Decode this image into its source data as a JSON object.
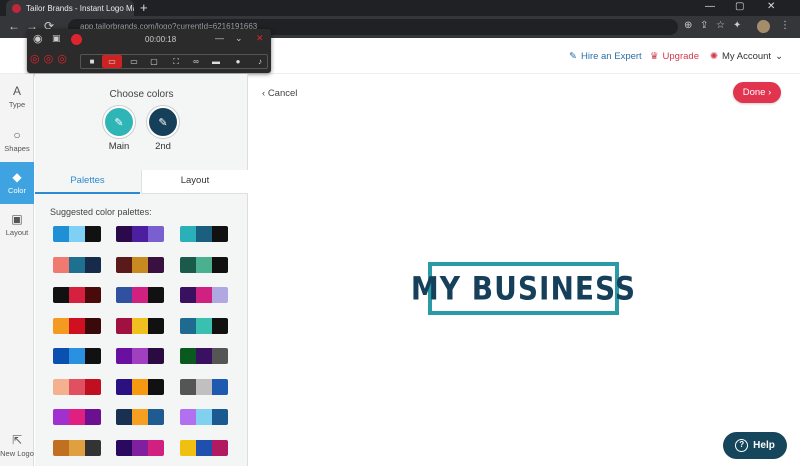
{
  "browser": {
    "tab_title": "Tailor Brands - Instant Logo Mak...",
    "tab_close": "×",
    "new_tab": "+",
    "url": "app.tailorbrands.com/logo?currentId=6216191663",
    "window_controls": [
      "—",
      "▢",
      "✕"
    ]
  },
  "recorder": {
    "time": "00:00:18"
  },
  "header": {
    "hire_label": "Hire an Expert",
    "upgrade_label": "Upgrade",
    "account_label": "My Account"
  },
  "rail": {
    "items": [
      {
        "label": "Type",
        "icon": "A"
      },
      {
        "label": "Shapes",
        "icon": "○"
      },
      {
        "label": "Color",
        "icon": "◆"
      },
      {
        "label": "Layout",
        "icon": "▣"
      }
    ],
    "new_logo": "New Logo"
  },
  "panel": {
    "title": "Choose colors",
    "main_label": "Main",
    "second_label": "2nd",
    "main_color": "#2fb5b5",
    "second_color": "#163f5a",
    "tab_palettes": "Palettes",
    "tab_layout": "Layout",
    "suggest_title": "Suggested color palettes:",
    "palettes": [
      [
        "#1f8fd6",
        "#7fd0f5",
        "#111111"
      ],
      [
        "#2a0a4a",
        "#4b1fa0",
        "#7a5fd0"
      ],
      [
        "#2ab0b8",
        "#1b5f80",
        "#111111"
      ],
      [
        "#f07a70",
        "#1f7090",
        "#162a4a"
      ],
      [
        "#5a1a1a",
        "#c88a20",
        "#3a1040"
      ],
      [
        "#1a5a4a",
        "#4ab090",
        "#111111"
      ],
      [
        "#111111",
        "#d62040",
        "#4a0a0a"
      ],
      [
        "#3050a0",
        "#d02080",
        "#111111"
      ],
      [
        "#3a1060",
        "#d02080",
        "#b0a8e0"
      ],
      [
        "#f59a20",
        "#d01020",
        "#3a0a0a"
      ],
      [
        "#a01040",
        "#f0c020",
        "#111111"
      ],
      [
        "#1f6a90",
        "#3ac0b0",
        "#111111"
      ],
      [
        "#0a50b0",
        "#2a90e0",
        "#111111"
      ],
      [
        "#6a10a0",
        "#a040c0",
        "#2a0a40"
      ],
      [
        "#0a5a20",
        "#3a1060",
        "#555555"
      ],
      [
        "#f5b090",
        "#e05060",
        "#c01020"
      ],
      [
        "#2a1080",
        "#f59a10",
        "#111111"
      ],
      [
        "#555555",
        "#c0c0c0",
        "#1f5ab0"
      ],
      [
        "#a030d0",
        "#e02080",
        "#6a1090"
      ],
      [
        "#1a3050",
        "#f5a020",
        "#1f5a90"
      ],
      [
        "#b070f0",
        "#80d0f0",
        "#1a5a90"
      ],
      [
        "#c07020",
        "#e0a040",
        "#333333"
      ],
      [
        "#2a0a60",
        "#8020a0",
        "#d02080"
      ],
      [
        "#f0c010",
        "#1f50b0",
        "#b01a60"
      ]
    ]
  },
  "canvas": {
    "cancel_label": "Cancel",
    "done_label": "Done",
    "logo_text": "MY BUSINESS",
    "help_label": "Help"
  }
}
